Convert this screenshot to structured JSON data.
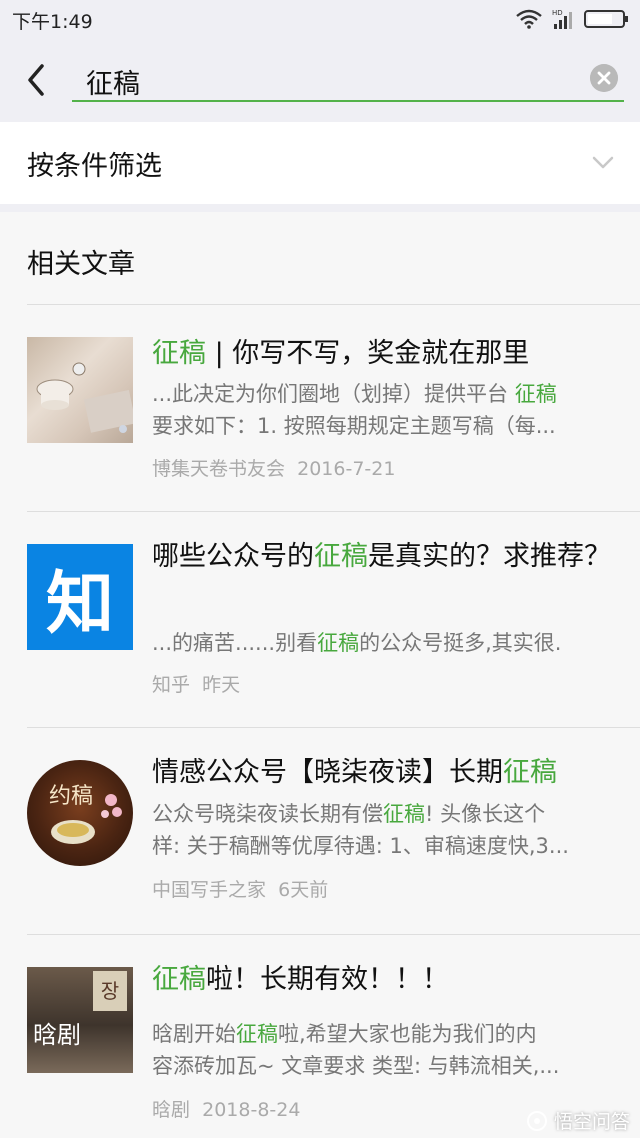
{
  "status_bar": {
    "time": "下午1:49"
  },
  "search": {
    "query": "征稿"
  },
  "filter": {
    "label": "按条件筛选"
  },
  "section": {
    "title": "相关文章"
  },
  "articles": [
    {
      "title_hl": "征稿",
      "title_rest": " | 你写不写，奖金就在那里",
      "snippet1_pre": "...此决定为你们圈地（划掉）提供平台 ",
      "snippet1_hl": "征稿",
      "snippet2": "要求如下：1. 按照每期规定主题写稿（每...",
      "source": "博集天卷书友会",
      "date": "2016-7-21"
    },
    {
      "title_pre": "哪些公众号的",
      "title_hl": "征稿",
      "title_rest": "是真实的？求推荐？",
      "thumb_char": "知",
      "snippet1_pre": "...的痛苦......别看",
      "snippet1_hl": "征稿",
      "snippet1_post": "的公众号挺多,其实很.",
      "source": "知乎",
      "date": "昨天"
    },
    {
      "title_pre": "情感公众号【晓柒夜读】长期",
      "title_hl": "征稿",
      "thumb_char": "约稿",
      "snippet1_pre": "公众号晓柒夜读长期有偿",
      "snippet1_hl": "征稿",
      "snippet1_post": "! 头像长这个",
      "snippet2": "样: 关于稿酬等优厚待遇: 1、审稿速度快,3...",
      "source": "中国写手之家",
      "date": "6天前"
    },
    {
      "title_hl": "征稿",
      "title_rest": "啦！长期有效！！！",
      "thumb_char": "晗剧",
      "snippet1_pre": "晗剧开始",
      "snippet1_hl": "征稿",
      "snippet1_post": "啦,希望大家也能为我们的内",
      "snippet2": "容添砖加瓦~ 文章要求 类型: 与韩流相关,...",
      "source": "晗剧",
      "date": "2018-8-24"
    }
  ],
  "watermark": {
    "text": "悟空问答"
  }
}
